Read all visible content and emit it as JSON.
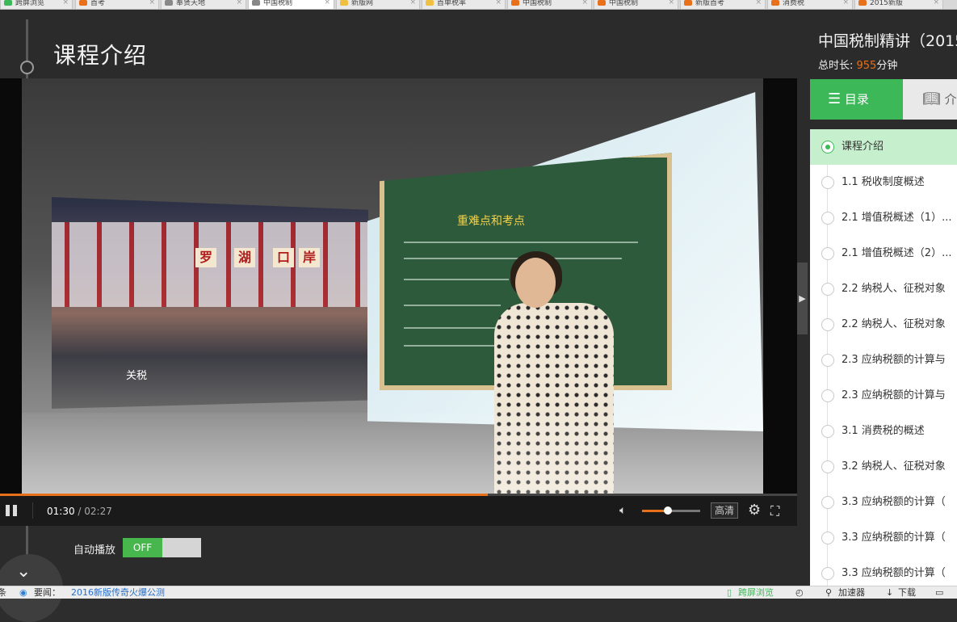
{
  "browser_tabs": [
    {
      "label": "跨屏浏览",
      "color": "#3cb858"
    },
    {
      "label": "首考",
      "color": "#e8701a"
    },
    {
      "label": "奉贤天地",
      "color": "#888888"
    },
    {
      "label": "中国税制",
      "color": "#888888"
    },
    {
      "label": "新版网",
      "color": "#f0c040"
    },
    {
      "label": "首单税率",
      "color": "#f0c040"
    },
    {
      "label": "中国税制",
      "color": "#e8701a"
    },
    {
      "label": "中国税制",
      "color": "#e8701a"
    },
    {
      "label": "新版首考",
      "color": "#e8701a"
    },
    {
      "label": "消费税",
      "color": "#e8701a"
    },
    {
      "label": "2015新版",
      "color": "#e8701a"
    }
  ],
  "page": {
    "title": "课程介绍"
  },
  "video": {
    "sign_chars": [
      "罗",
      "湖",
      "口",
      "岸"
    ],
    "caption_left": "关税",
    "board_title": "重难点和考点"
  },
  "player": {
    "current_time": "01:30",
    "total_time": "/ 02:27",
    "progress_fraction": 0.612,
    "volume_fraction": 0.45,
    "quality_label": "高清",
    "autoplay_label": "自动播放",
    "autoplay_state": "OFF"
  },
  "course": {
    "title": "中国税制精讲（2015",
    "duration_label": "总时长: ",
    "duration_value": "955",
    "duration_unit": "分钟",
    "tabs": [
      {
        "label": "目录",
        "icon": "list-icon"
      },
      {
        "label": "介",
        "icon": "book-icon"
      }
    ],
    "chapters": [
      "课程介绍",
      "1.1 税收制度概述",
      "2.1 增值税概述（1）...",
      "2.1 增值税概述（2）...",
      "2.2 纳税人、征税对象",
      "2.2 纳税人、征税对象",
      "2.3 应纳税额的计算与",
      "2.3 应纳税额的计算与",
      "3.1 消费税的概述",
      "3.2 纳税人、征税对象",
      "3.3 应纳税额的计算（",
      "3.3 应纳税额的计算（",
      "3.3 应纳税额的计算（"
    ],
    "active_index": 0
  },
  "status_bar": {
    "left_label": "头条",
    "news_label": "要闻：",
    "news_link": "2016新版传奇火爆公测",
    "crossscreen": "跨屏浏览",
    "accelerator": "加速器",
    "download": "下载"
  }
}
